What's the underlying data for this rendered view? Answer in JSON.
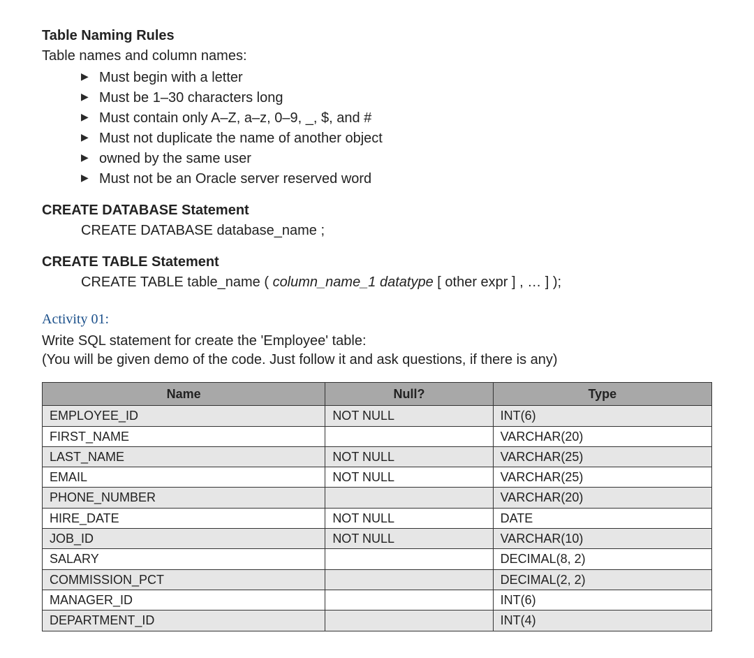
{
  "section1": {
    "heading": "Table Naming Rules",
    "subtext": "Table names and column names:",
    "bullets": [
      "Must begin with a letter",
      "Must be 1–30 characters long",
      "Must contain only A–Z, a–z, 0–9, _, $, and #",
      "Must not duplicate the name of another object",
      "owned by the same user",
      "Must not be an Oracle server reserved word"
    ]
  },
  "section2": {
    "heading": "CREATE DATABASE Statement",
    "code": "CREATE DATABASE database_name ;"
  },
  "section3": {
    "heading": "CREATE TABLE Statement",
    "code_prefix": "CREATE TABLE table_name ( ",
    "code_italic": "column_name_1 datatype",
    "code_suffix": " [ other expr ] , … ] );"
  },
  "activity": {
    "heading": "Activity 01:",
    "line1": "Write SQL statement for create the 'Employee' table:",
    "line2": "(You will be given demo of the code. Just follow it and ask questions, if there is any)"
  },
  "table": {
    "headers": [
      "Name",
      "Null?",
      "Type"
    ],
    "rows": [
      {
        "name": "EMPLOYEE_ID",
        "null": "NOT NULL",
        "type": "INT(6)"
      },
      {
        "name": "FIRST_NAME",
        "null": "",
        "type": "VARCHAR(20)"
      },
      {
        "name": "LAST_NAME",
        "null": "NOT NULL",
        "type": "VARCHAR(25)"
      },
      {
        "name": "EMAIL",
        "null": "NOT NULL",
        "type": "VARCHAR(25)"
      },
      {
        "name": "PHONE_NUMBER",
        "null": "",
        "type": "VARCHAR(20)"
      },
      {
        "name": "HIRE_DATE",
        "null": "NOT NULL",
        "type": "DATE"
      },
      {
        "name": "JOB_ID",
        "null": "NOT NULL",
        "type": "VARCHAR(10)"
      },
      {
        "name": "SALARY",
        "null": "",
        "type": "DECIMAL(8, 2)"
      },
      {
        "name": "COMMISSION_PCT",
        "null": "",
        "type": "DECIMAL(2, 2)"
      },
      {
        "name": "MANAGER_ID",
        "null": "",
        "type": "INT(6)"
      },
      {
        "name": "DEPARTMENT_ID",
        "null": "",
        "type": "INT(4)"
      }
    ]
  }
}
